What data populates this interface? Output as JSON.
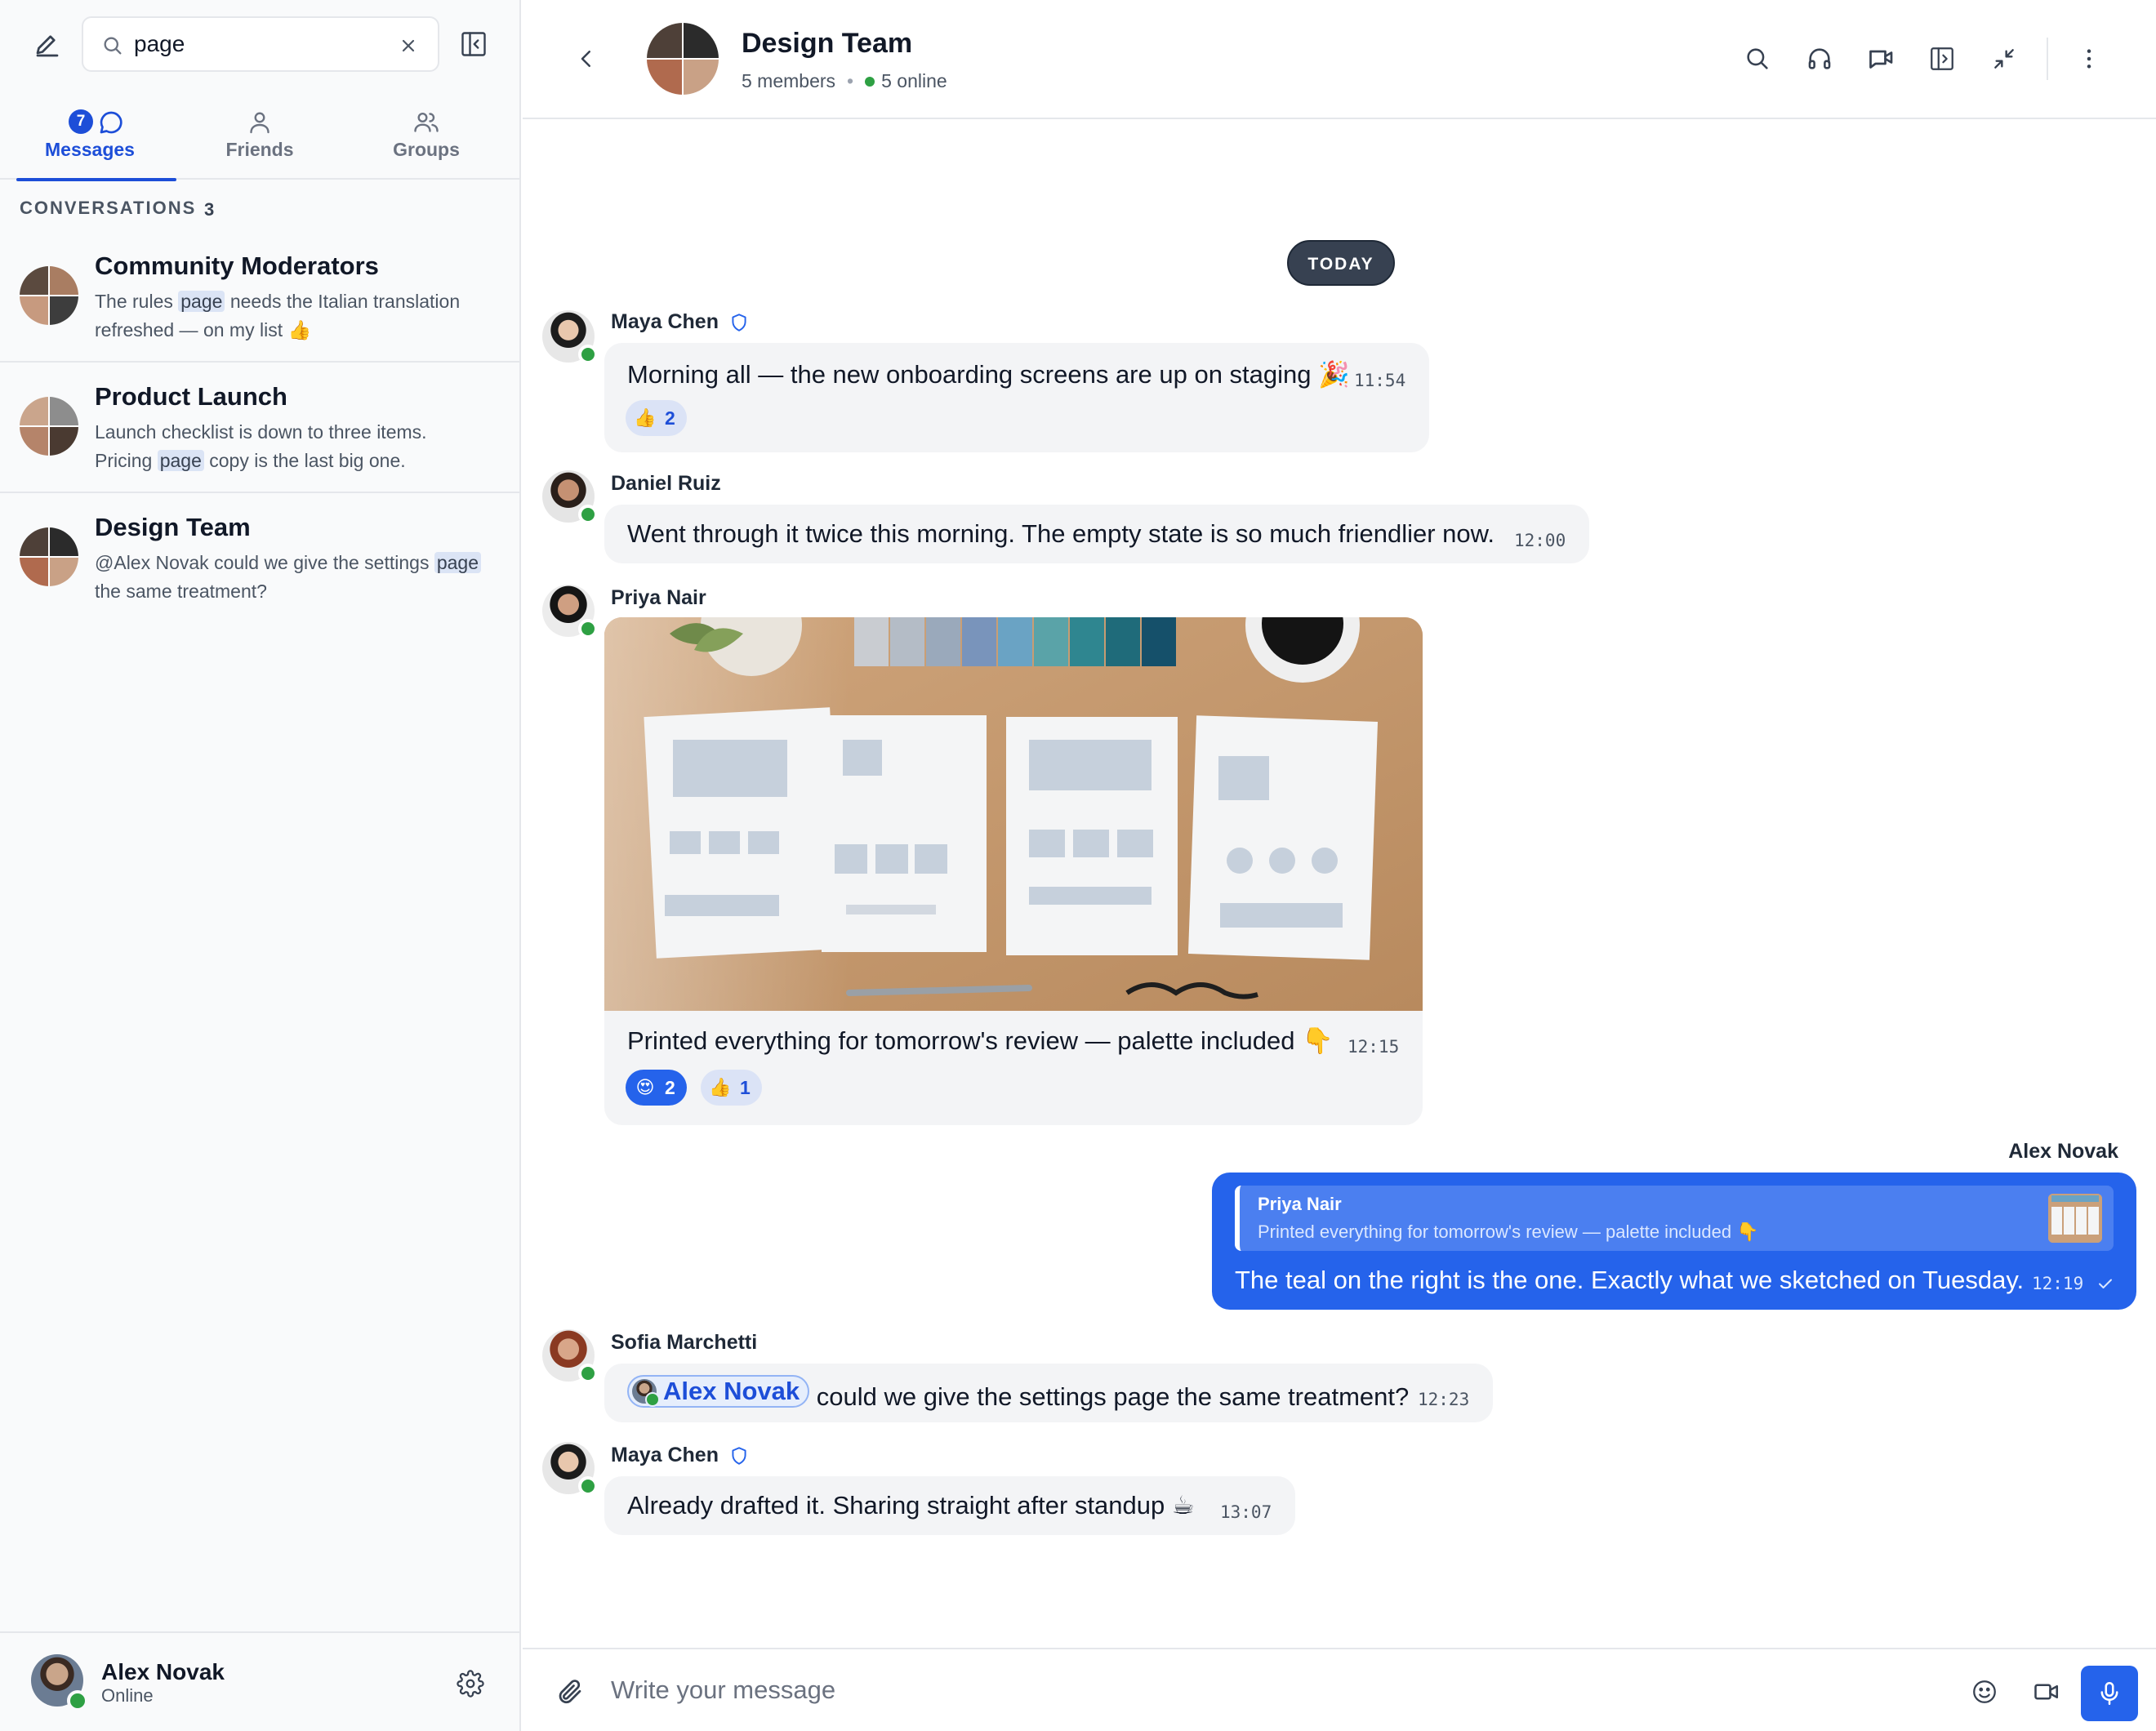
{
  "sidebar": {
    "search": {
      "value": "page",
      "placeholder": ""
    },
    "tabs": [
      {
        "label": "Messages",
        "badge": "7",
        "active": true
      },
      {
        "label": "Friends"
      },
      {
        "label": "Groups"
      }
    ],
    "section": {
      "label": "CONVERSATIONS",
      "count": "3"
    },
    "conversations": [
      {
        "title": "Community Moderators",
        "preview_a": "The rules ",
        "match": "page",
        "preview_b": " needs the Italian translation",
        "preview_c": "refreshed — on my list 👍"
      },
      {
        "title": "Product Launch",
        "preview_a": "Launch checklist is down to three items.",
        "preview_b": "Pricing ",
        "match": "page",
        "preview_c": " copy is the last big one."
      },
      {
        "title": "Design Team",
        "preview_a": "@Alex Novak could we give the settings ",
        "match": "page",
        "preview_b": "the same treatment?"
      }
    ],
    "me": {
      "name": "Alex Novak",
      "status": "Online"
    }
  },
  "header": {
    "title": "Design Team",
    "members": "5 members",
    "online": "5 online"
  },
  "chat": {
    "date": "TODAY",
    "messages": [
      {
        "sender": "Maya Chen",
        "text": "Morning all — the new onboarding screens are up on staging 🎉",
        "time": "11:54",
        "reactions": [
          {
            "emoji": "thumbs-up",
            "count": "2"
          }
        ]
      },
      {
        "sender": "Daniel Ruiz",
        "text": "Went through it twice this morning. The empty state is so much friendlier now.",
        "time": "12:00"
      },
      {
        "sender": "Priya Nair",
        "text": "Printed everything for tomorrow's review — palette included 👇",
        "time": "12:15",
        "reactions": [
          {
            "emoji": "heart-eyes",
            "count": "2"
          },
          {
            "emoji": "thumbs-up",
            "count": "1"
          }
        ]
      },
      {
        "sender": "Alex Novak",
        "quote_name": "Priya Nair",
        "quote_text": "Printed everything for tomorrow's review — palette included 👇",
        "text": "The teal on the right is the one. Exactly what we sketched on Tuesday.",
        "time": "12:19"
      },
      {
        "sender": "Sofia Marchetti",
        "mention": "Alex Novak",
        "text": "could we give the settings page the same treatment?",
        "time": "12:23"
      },
      {
        "sender": "Maya Chen",
        "text": "Already drafted it. Sharing straight after standup ☕",
        "time": "13:07"
      }
    ]
  },
  "composer": {
    "placeholder": "Write your message"
  },
  "colors": {
    "accent": "#2563eb",
    "online": "#2ea043",
    "bubble": "#f3f4f6"
  }
}
